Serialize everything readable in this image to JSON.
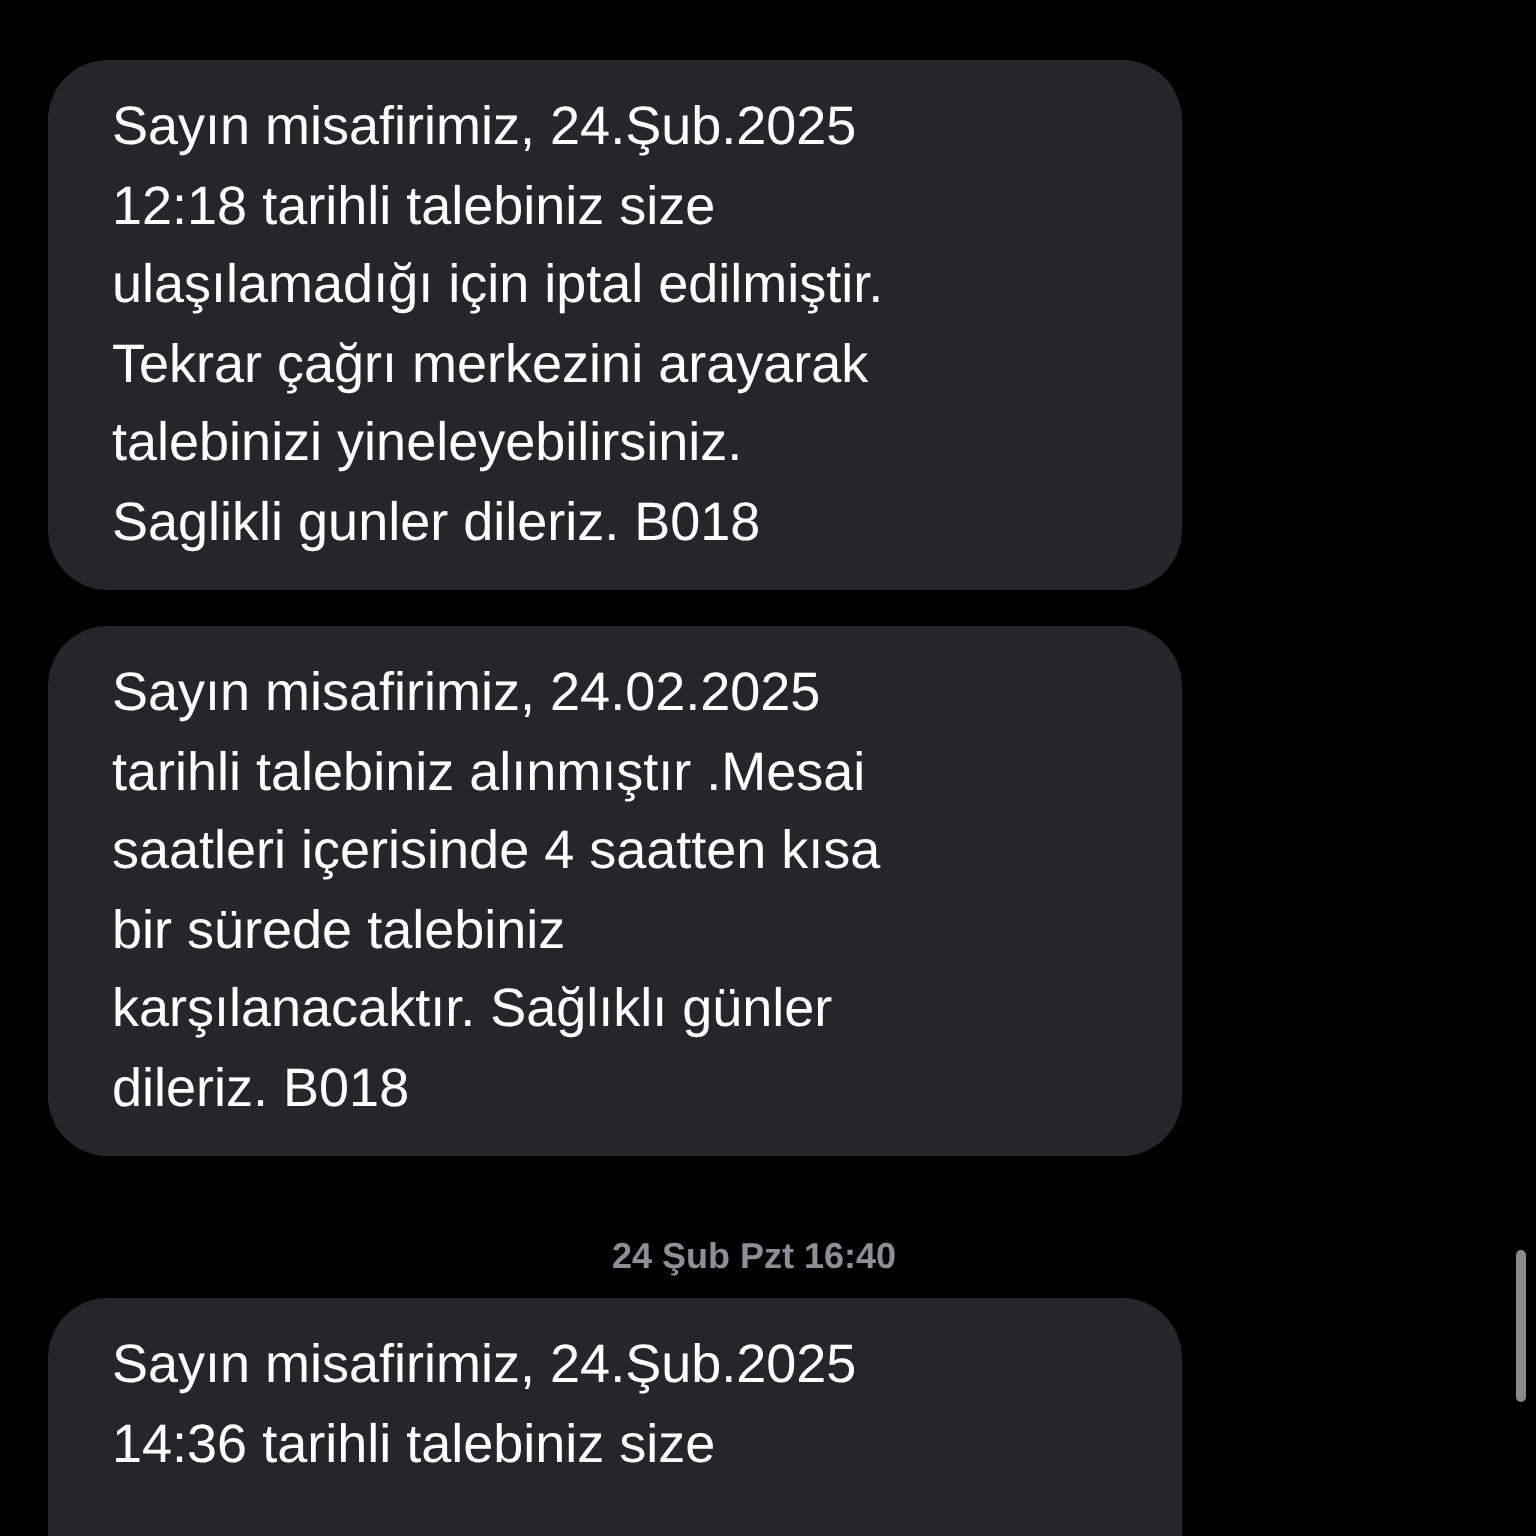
{
  "messages": [
    {
      "kind": "bubble",
      "text": "Sayın misafirimiz, 24.Şub.2025\n12:18 tarihli talebiniz size\nulaşılamadığı için iptal edilmiştir.\nTekrar çağrı merkezini arayarak\ntalebinizi yineleyebilirsiniz.\nSaglikli gunler dileriz. B018"
    },
    {
      "kind": "bubble",
      "text": "Sayın misafirimiz, 24.02.2025\ntarihli talebiniz alınmıştır .Mesai\nsaatleri içerisinde 4 saatten kısa\nbir sürede talebiniz\nkarşılanacaktır. Sağlıklı günler\ndileriz. B018"
    },
    {
      "kind": "timestamp",
      "text": "24 Şub Pzt 16:40"
    },
    {
      "kind": "cut-bubble",
      "text": "Sayın misafirimiz, 24.Şub.2025\n14:36 tarihli talebiniz size"
    }
  ]
}
